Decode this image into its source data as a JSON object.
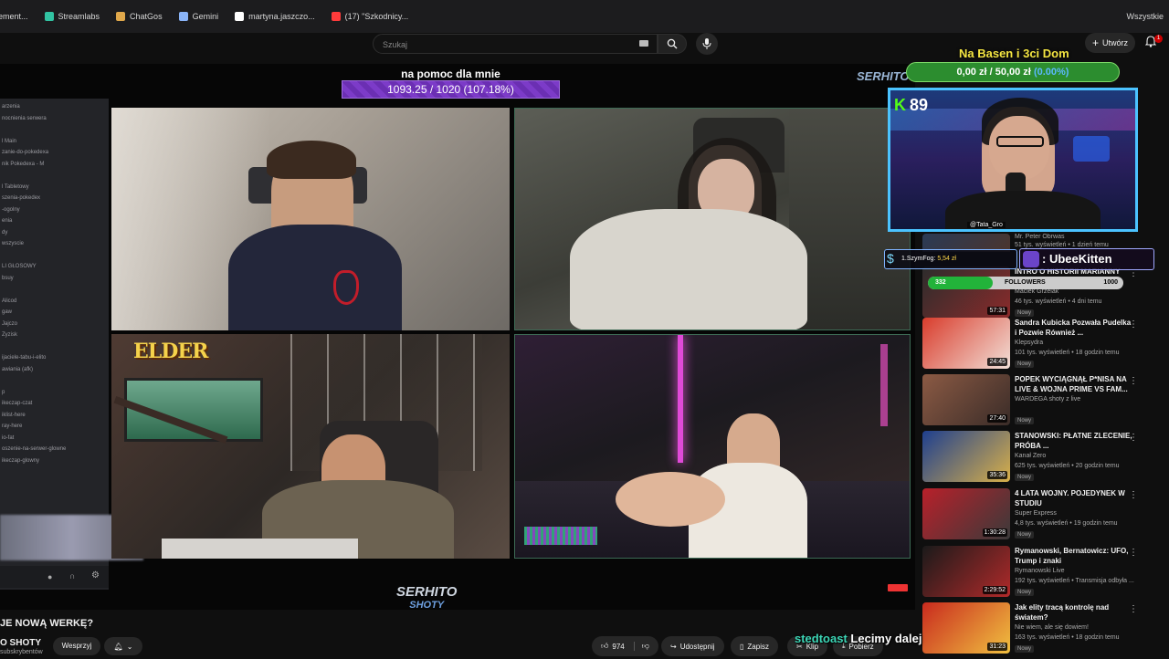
{
  "bookmarks": [
    {
      "label": "ement...",
      "color": "#888888"
    },
    {
      "label": "Streamlabs",
      "color": "#31c3a2"
    },
    {
      "label": "ChatGos",
      "color": "#e0a84b"
    },
    {
      "label": "Gemini",
      "color": "#8ab4f8"
    },
    {
      "label": "martyna.jaszczo...",
      "color": "#ffffff"
    },
    {
      "label": "(17) \"Szkodnicy...",
      "color": "#ff3b3b"
    }
  ],
  "bookmarks_all": "Wszystkie",
  "header": {
    "search_placeholder": "Szukaj",
    "create_label": "Utwórz",
    "bell_count": "1"
  },
  "discord": {
    "lines": [
      "arzenia",
      "nocnienia serwera",
      "",
      "l Main",
      "zanie-do-pokedexa",
      "nik Pokedexa - M",
      "",
      "l Tabletowy",
      "szenia-pokedex",
      "-ogolny",
      "enia",
      "dy",
      "wszyscie",
      "",
      "LI GŁOSOWY",
      "bsuy",
      "",
      "Alicod",
      "gaw",
      "Jajczo",
      "Zyzisk",
      "",
      "ijaciele-tabu-i-elito",
      "awiania (afk)",
      "",
      "p",
      "ikeczap-czat",
      "iklist-here",
      "ray-here",
      "io-fat",
      "oszenie-na-serwer-glowne",
      "ikeczap-glowny"
    ]
  },
  "stream": {
    "goal_title": "na pomoc dla mnie",
    "goal_text": "1093.25 / 1020 (107.18%)",
    "goal_progress": 1.0718,
    "elder_logo": "ELDER",
    "serhito_top": "SERHITO",
    "serhito_main": "SERHITO",
    "serhito_sub": "SHOTY"
  },
  "overlay": {
    "donation_title": "Na Basen i 3ci Dom",
    "donation_amount": "0,00 zł",
    "donation_goal": "/ 50,00 zł",
    "donation_pct": "(0.00%)",
    "viewer_count": "89",
    "streamer_handle": "@Tata_Gro",
    "tip_user": "1.SzymFog:",
    "tip_amount": "5,54 zł",
    "kitten_name": ": UbeeKitten",
    "followers_current": "332",
    "followers_label": "FOLLOWERS",
    "followers_goal": "1000",
    "followers_progress": 0.332
  },
  "recommendations": [
    {
      "title": "",
      "channel": "Mr. Peter Obrwas",
      "meta": "51 tys. wyświetleń • 1 dzień temu",
      "badge": "",
      "duration": "",
      "color1": "#2a3a55",
      "color2": "#553322"
    },
    {
      "title": "INTRO O HISTORII MARIANNY SCHREIBER",
      "channel": "Maciek Grzelak",
      "meta": "46 tys. wyświetleń • 4 dni temu",
      "badge": "Nowy",
      "duration": "57:31",
      "color1": "#2c2c2c",
      "color2": "#8a2b2b"
    },
    {
      "title": "Sandra Kubicka Pozwała Pudelka i Pozwie Również ...",
      "channel": "Klepsydra",
      "meta": "101 tys. wyświetleń • 18 godzin temu",
      "badge": "Nowy",
      "duration": "24:45",
      "color1": "#d93c2c",
      "color2": "#f2e0d8"
    },
    {
      "title": "POPEK WYCIĄGNĄŁ P*NISA NA LIVE & WOJNA PRIME VS FAM...",
      "channel": "WARDEGA shoty z live",
      "meta": "",
      "badge": "Nowy",
      "duration": "27:40",
      "color1": "#8b5a44",
      "color2": "#3a2c28"
    },
    {
      "title": "STANOWSKI: PŁATNE ZLECENIE, PRÓBA ...",
      "channel": "Kanał Zero",
      "meta": "625 tys. wyświetleń • 20 godzin temu",
      "badge": "Nowy",
      "duration": "35:36",
      "color1": "#1e3f8f",
      "color2": "#d8b04a"
    },
    {
      "title": "4 LATA WOJNY. POJEDYNEK W STUDIU",
      "channel": "Super Express",
      "meta": "4,8 tys. wyświetleń • 19 godzin temu",
      "badge": "Nowy",
      "duration": "1:30:28",
      "color1": "#b8202a",
      "color2": "#3a3a3a"
    },
    {
      "title": "Rymanowski, Bernatowicz: UFO, Trump i znaki",
      "channel": "Rymanowski Live",
      "meta": "192 tys. wyświetleń • Transmisja odbyła ...",
      "badge": "Nowy",
      "duration": "2:29:52",
      "color1": "#1a1a1a",
      "color2": "#b12a2a"
    },
    {
      "title": "Jak elity tracą kontrolę nad światem?",
      "channel": "Nie wiem, ale się dowiem!",
      "meta": "163 tys. wyświetleń • 18 godzin temu",
      "badge": "Nowy",
      "duration": "31:23",
      "color1": "#c92a1e",
      "color2": "#f0c040"
    }
  ],
  "bottom": {
    "video_title": "JE NOWĄ WERKĘ?",
    "channel_name": "O SHOTY",
    "channel_subs": "subskrybentów",
    "support_label": "Wesprzyj",
    "likes": "974",
    "share_label": "Udostępnij",
    "save_label": "Zapisz",
    "clip_label": "Klip",
    "download_label": "Pobierz",
    "chat_user": "stedtoast",
    "chat_message": "Lecimy dalej"
  }
}
